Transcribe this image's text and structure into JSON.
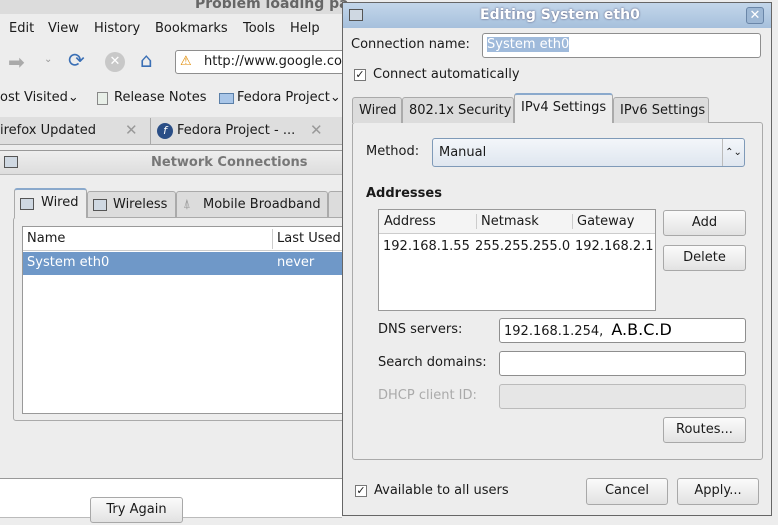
{
  "browser": {
    "title": "Problem loading pa",
    "menu": [
      "Edit",
      "View",
      "History",
      "Bookmarks",
      "Tools",
      "Help"
    ],
    "url": "http://www.google.co",
    "bookmarks": [
      "ost Visited⌄",
      "Release Notes",
      "Fedora Project⌄"
    ],
    "tabs": [
      "irefox Updated",
      "Fedora Project - ..."
    ],
    "try_again": "Try Again"
  },
  "network_connections": {
    "title": "Network Connections",
    "tabs": [
      "Wired",
      "Wireless",
      "Mobile Broadband"
    ],
    "columns": [
      "Name",
      "Last Used"
    ],
    "rows": [
      {
        "name": "System eth0",
        "last_used": "never"
      }
    ],
    "selection_color": "#6f98c8"
  },
  "dialog": {
    "title": "Editing System eth0",
    "connection_name_label": "Connection name:",
    "connection_name": "System eth0",
    "connect_automatically": "Connect automatically",
    "tabs": [
      "Wired",
      "802.1x Security",
      "IPv4 Settings",
      "IPv6 Settings"
    ],
    "method_label": "Method:",
    "method": "Manual",
    "addresses_heading": "Addresses",
    "columns": [
      "Address",
      "Netmask",
      "Gateway"
    ],
    "rows": [
      {
        "address": "192.168.1.55",
        "netmask": "255.255.255.0",
        "gateway": "192.168.2.1"
      }
    ],
    "add": "Add",
    "delete": "Delete",
    "dns_label": "DNS servers:",
    "dns_value": "192.168.1.254,",
    "dns_annotation": "A.B.C.D",
    "search_label": "Search domains:",
    "search_value": "",
    "dhcp_label": "DHCP client ID:",
    "routes": "Routes...",
    "available_all": "Available to all users",
    "cancel": "Cancel",
    "apply": "Apply...",
    "titlebar_color": "#b3cbe4"
  }
}
